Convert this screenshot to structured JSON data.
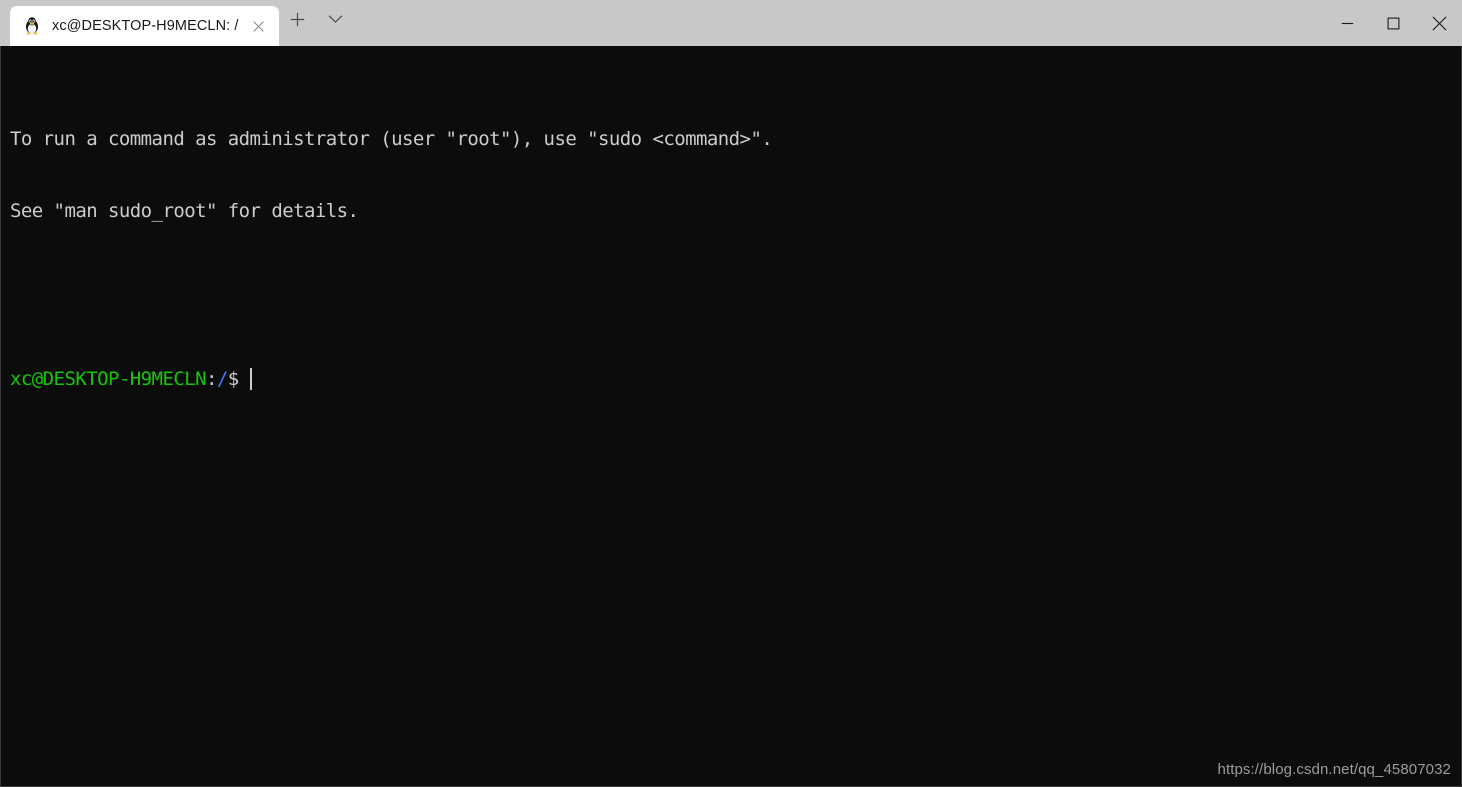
{
  "window": {
    "titlebar": {
      "tab": {
        "icon": "tux-linux-icon",
        "title": "xc@DESKTOP-H9MECLN: /",
        "close_label": "×"
      },
      "new_tab_label": "+",
      "dropdown_label": "∨",
      "controls": {
        "minimize_label": "—",
        "maximize_label": "□",
        "close_label": "✕"
      },
      "colors": {
        "bar_bg": "#c8c8c8",
        "tab_bg": "#ffffff",
        "tab_text": "#191919"
      }
    },
    "terminal": {
      "colors": {
        "background": "#0c0c0c",
        "foreground": "#cccccc",
        "green": "#16c60c",
        "blue": "#3b78ff",
        "border": "#3b3b3b"
      },
      "lines": [
        "To run a command as administrator (user \"root\"), use \"sudo <command>\".",
        "See \"man sudo_root\" for details.",
        ""
      ],
      "prompt": {
        "user_host": "xc@DESKTOP-H9MECLN",
        "separator": ":",
        "path": "/",
        "sigil": "$",
        "input": ""
      }
    },
    "watermark": "https://blog.csdn.net/qq_45807032"
  }
}
